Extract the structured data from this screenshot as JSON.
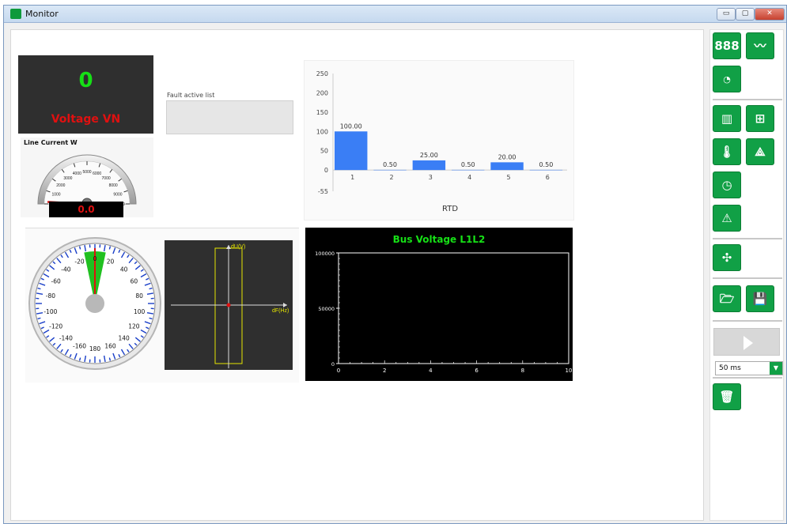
{
  "window": {
    "title": "Monitor",
    "min_label": "▭",
    "max_label": "▢",
    "close_label": "✕"
  },
  "digital_display": {
    "value": "0",
    "label": "Voltage VN",
    "value_color": "#16e016",
    "label_color": "#e01010"
  },
  "line_current_gauge": {
    "title": "Line Current W",
    "value": "0.0",
    "scale_labels": [
      "0",
      "1000",
      "2000",
      "3000",
      "4000",
      "5000",
      "6000",
      "7000",
      "8000",
      "9000",
      "10000"
    ],
    "scale_max": 10000,
    "needle_value": 0
  },
  "fault_list": {
    "label": "Fault active list",
    "items": []
  },
  "rtd_chart": {
    "chart_data": {
      "type": "bar",
      "categories": [
        "1",
        "2",
        "3",
        "4",
        "5",
        "6"
      ],
      "values": [
        100.0,
        0.5,
        25.0,
        0.5,
        20.0,
        0.5
      ],
      "data_labels": [
        "100.00",
        "0.50",
        "25.00",
        "0.50",
        "20.00",
        "0.50"
      ],
      "xlabel": "RTD",
      "ylabel": "",
      "ylim": [
        -55,
        250
      ],
      "yticks": [
        "250",
        "200",
        "150",
        "100",
        "50",
        "0",
        "-55"
      ],
      "bar_color": "#3a7ef5"
    }
  },
  "phasor_dial": {
    "labels_left": [
      "-20",
      "-40",
      "-60",
      "-80",
      "-100",
      "-120",
      "-140",
      "-160"
    ],
    "labels_right": [
      "20",
      "40",
      "60",
      "80",
      "100",
      "120",
      "140",
      "160"
    ],
    "labels_top": [
      "0"
    ],
    "label_bottom": "180",
    "sector_color": "#20c020"
  },
  "synchro_plot": {
    "y_label": "dU(V)",
    "x_label": "dF(Hz)"
  },
  "bus_voltage_chart": {
    "chart_data": {
      "type": "line",
      "title": "Bus Voltage L1L2",
      "x_ticks": [
        "0",
        "2",
        "4",
        "6",
        "8",
        "10"
      ],
      "y_ticks": [
        "100000",
        "50000",
        "0"
      ],
      "xlim": [
        0,
        10
      ],
      "ylim": [
        0,
        100000
      ],
      "series": []
    }
  },
  "sidebar": {
    "buttons": [
      {
        "name": "digital-display-button",
        "icon": "888"
      },
      {
        "name": "trend-button",
        "icon": "trend-icon"
      },
      {
        "name": "analog-gauge-button",
        "icon": "gauge-icon"
      },
      {
        "name": "bar-chart-button",
        "icon": "bar-chart-icon"
      },
      {
        "name": "table-button",
        "icon": "table-icon"
      },
      {
        "name": "temperature-button",
        "icon": "thermometer-icon"
      },
      {
        "name": "phasor-button",
        "icon": "phasor-icon"
      },
      {
        "name": "clock-button",
        "icon": "clock-icon"
      },
      {
        "name": "alarm-button",
        "icon": "warning-icon"
      },
      {
        "name": "synchro-button",
        "icon": "synchro-icon"
      },
      {
        "name": "open-button",
        "icon": "folder-icon"
      },
      {
        "name": "save-button",
        "icon": "save-icon"
      },
      {
        "name": "play-button",
        "icon": "play-icon"
      },
      {
        "name": "delete-button",
        "icon": "trash-icon"
      }
    ],
    "interval": "50 ms",
    "accent": "#11a046"
  }
}
